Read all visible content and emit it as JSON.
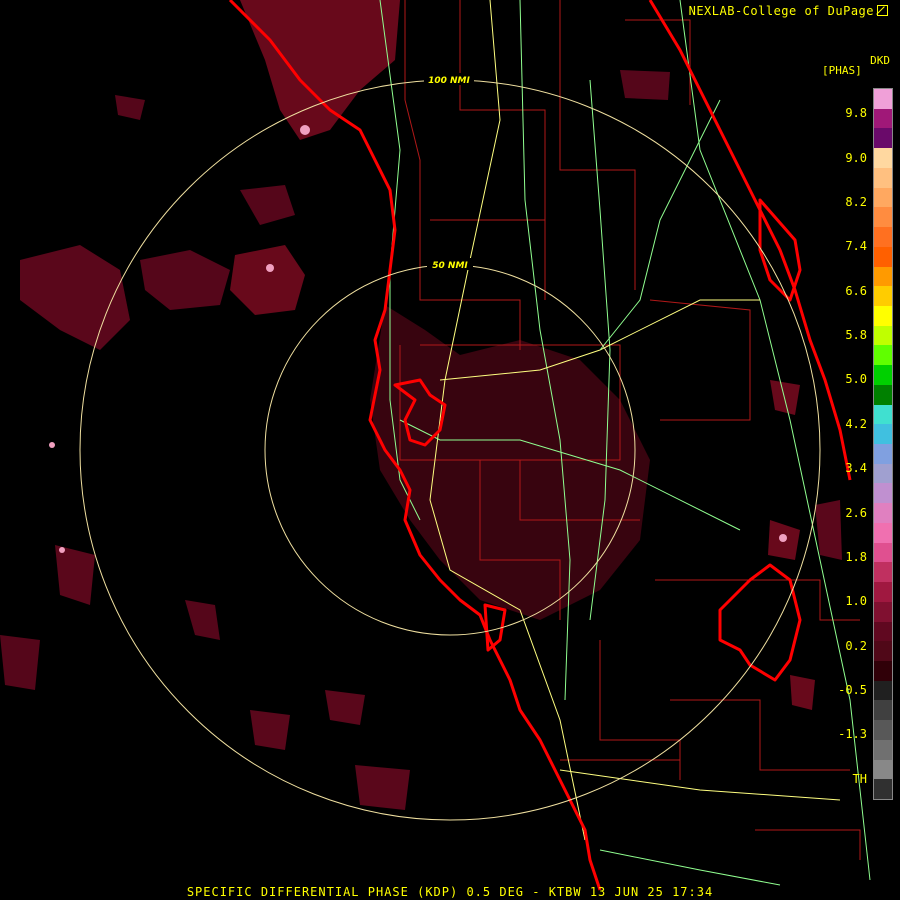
{
  "header": {
    "credit": "NEXLAB-College of DuPage"
  },
  "legend": {
    "product": "DKD",
    "unit": "[PHAS]",
    "ticks": [
      "9.8",
      "9.0",
      "8.2",
      "7.4",
      "6.6",
      "5.8",
      "5.0",
      "4.2",
      "3.4",
      "2.6",
      "1.8",
      "1.0",
      "0.2",
      "-0.5",
      "-1.3",
      "TH"
    ],
    "colors": [
      "#f0a0d8",
      "#a01878",
      "#6a0a6a",
      "#ffd8a0",
      "#ffc080",
      "#ffa860",
      "#ff8c40",
      "#ff7020",
      "#ff6000",
      "#ff9a00",
      "#ffcc00",
      "#ffff00",
      "#c0ff00",
      "#60ff00",
      "#00d000",
      "#008000",
      "#40e0d0",
      "#40c0e0",
      "#80a0e0",
      "#a0a0d0",
      "#c090d0",
      "#e080c0",
      "#f070b0",
      "#e05090",
      "#c03060",
      "#a01840",
      "#801030",
      "#600820",
      "#500818",
      "#300008",
      "#202020",
      "#404040",
      "#585858",
      "#707070",
      "#888888",
      "#303030"
    ]
  },
  "map": {
    "range_rings": [
      "100 NMI",
      "50 NMI"
    ]
  },
  "footer": {
    "caption": "SPECIFIC DIFFERENTIAL PHASE (KDP) 0.5 DEG - KTBW 13 JUN 25 17:34"
  },
  "colors": {
    "text": "#ffff00",
    "coast": "#ff0000",
    "county": "#b01818",
    "roads": "#90ff90",
    "highway": "#ffff80",
    "rings": "#f0e0a0"
  }
}
